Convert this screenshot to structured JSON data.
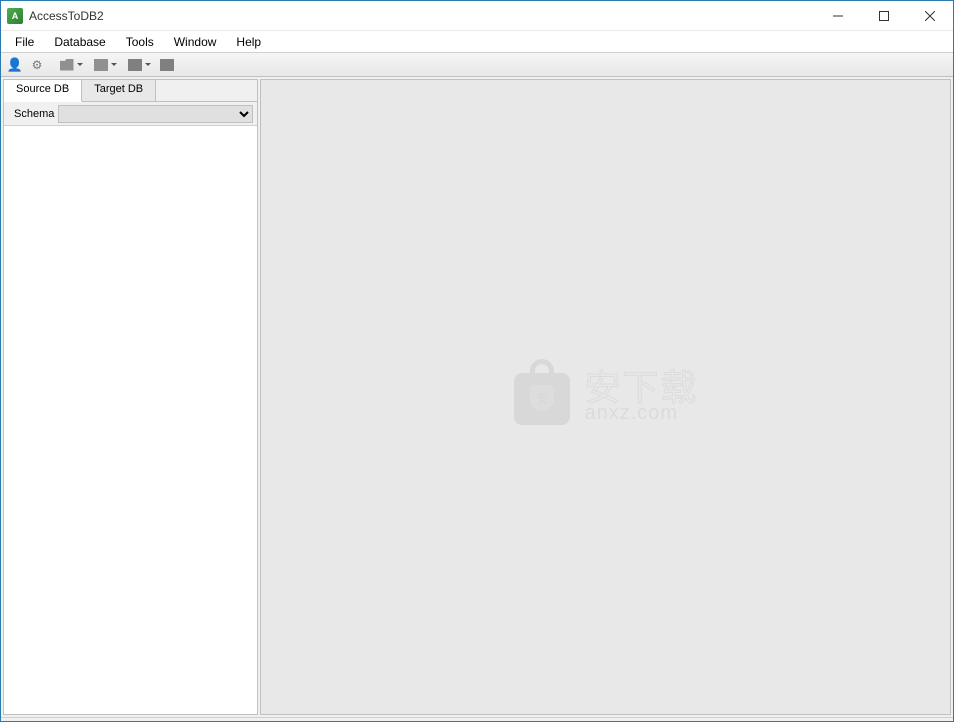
{
  "titlebar": {
    "app_icon_text": "A",
    "title": "AccessToDB2"
  },
  "menubar": {
    "items": [
      "File",
      "Database",
      "Tools",
      "Window",
      "Help"
    ]
  },
  "toolbar": {
    "buttons": [
      {
        "name": "user-icon"
      },
      {
        "name": "config-icon"
      },
      {
        "name": "import-dropdown"
      },
      {
        "name": "export-dropdown"
      },
      {
        "name": "task-dropdown"
      },
      {
        "name": "run-icon"
      }
    ]
  },
  "left_panel": {
    "tabs": [
      {
        "label": "Source DB",
        "active": true
      },
      {
        "label": "Target DB",
        "active": false
      }
    ],
    "schema_label": "Schema",
    "schema_value": ""
  },
  "watermark": {
    "shield_text": "安",
    "cn_text": "安下载",
    "en_text": "anxz.com"
  }
}
